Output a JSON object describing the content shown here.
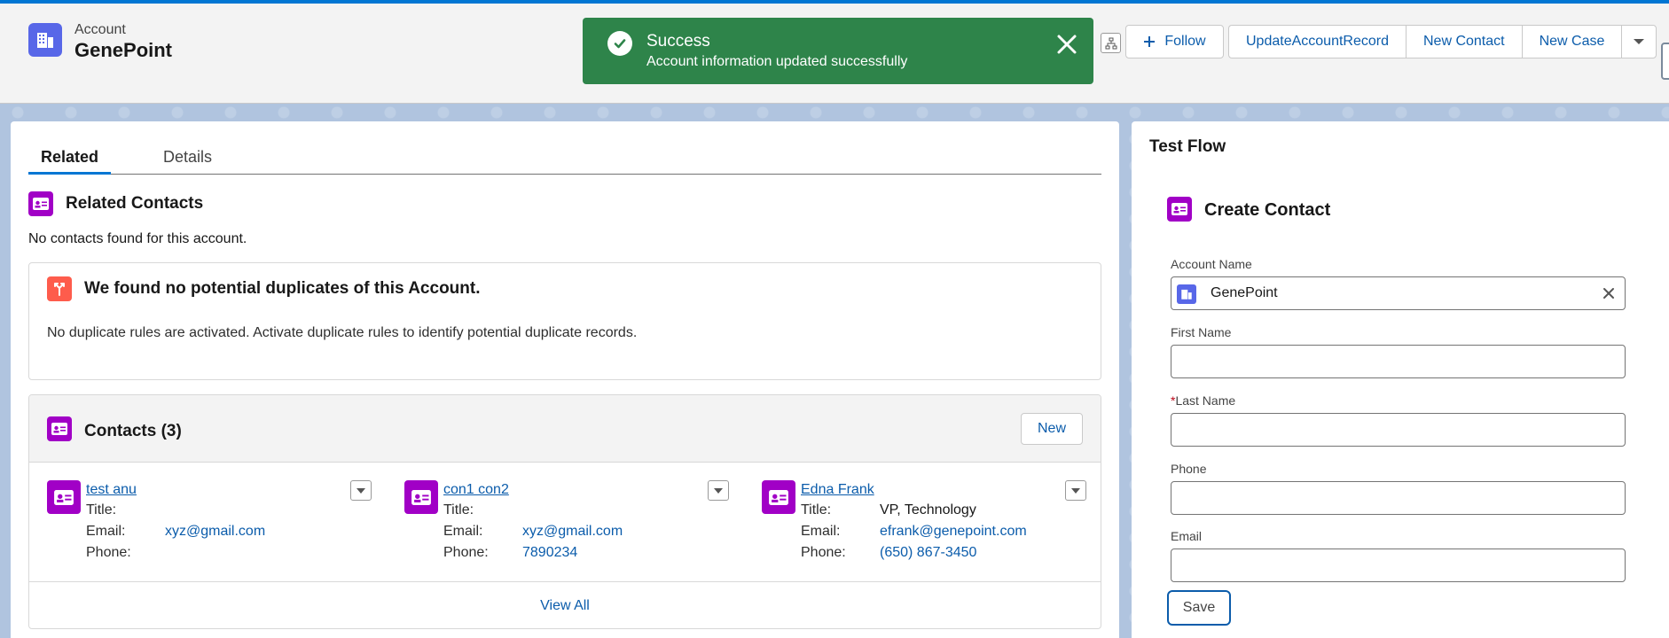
{
  "header": {
    "object_type": "Account",
    "record_name": "GenePoint",
    "follow_label": "Follow",
    "actions": [
      "UpdateAccountRecord",
      "New Contact",
      "New Case"
    ]
  },
  "toast": {
    "title": "Success",
    "message": "Account information updated successfully",
    "color": "#2e844a"
  },
  "tabs": {
    "related": "Related",
    "details": "Details"
  },
  "related_contacts": {
    "title": "Related Contacts",
    "empty_message": "No contacts found for this account."
  },
  "duplicates": {
    "title": "We found no potential duplicates of this Account.",
    "message": "No duplicate rules are activated. Activate duplicate rules to identify potential duplicate records."
  },
  "contacts": {
    "title": "Contacts (3)",
    "new_label": "New",
    "view_all": "View All",
    "field_labels": {
      "title": "Title:",
      "email": "Email:",
      "phone": "Phone:"
    },
    "items": [
      {
        "name": "test anu",
        "title": "",
        "email": "xyz@gmail.com",
        "phone": ""
      },
      {
        "name": "con1 con2",
        "title": "",
        "email": "xyz@gmail.com",
        "phone": "7890234"
      },
      {
        "name": "Edna Frank",
        "title": "VP, Technology",
        "email": "efrank@genepoint.com",
        "phone": "(650) 867-3450"
      }
    ]
  },
  "flow": {
    "title": "Test Flow",
    "form_title": "Create Contact",
    "account_name_label": "Account Name",
    "account_name_value": "GenePoint",
    "first_name_label": "First Name",
    "last_name_label": "Last Name",
    "required_mark": "*",
    "phone_label": "Phone",
    "email_label": "Email",
    "save_label": "Save"
  },
  "colors": {
    "brand": "#0176d3",
    "account_icon": "#5867e8",
    "contact_icon": "#a100c6",
    "duplicate_icon": "#fe5c4c",
    "link": "#0b5cab"
  }
}
